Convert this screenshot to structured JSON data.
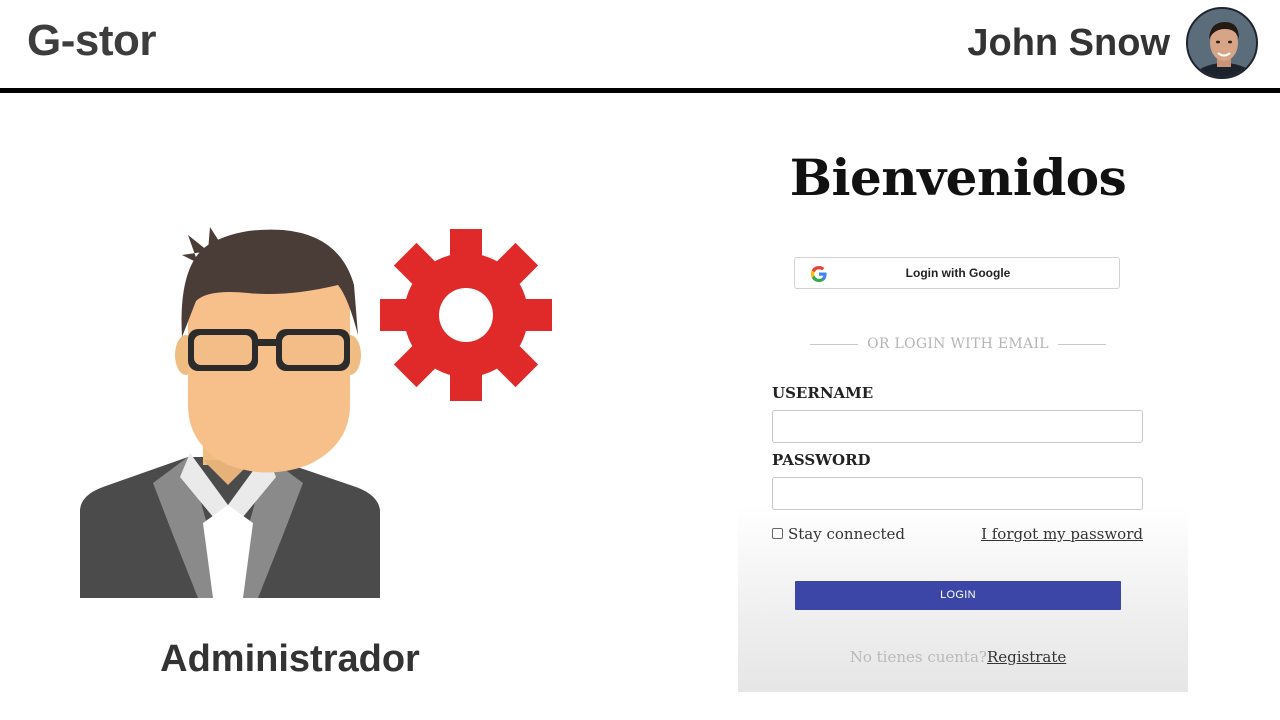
{
  "header": {
    "brand": "G-stor",
    "user_name": "John Snow",
    "avatar_icon": "user-avatar-photo"
  },
  "admin": {
    "label": "Administrador",
    "illustration_icons": [
      "admin-person-icon",
      "gear-icon"
    ],
    "gear_color": "#e02a2a"
  },
  "login": {
    "title": "Bienvenidos",
    "google_button": "Login with Google",
    "separator": "OR LOGIN WITH EMAIL",
    "username_label": "USERNAME",
    "username_value": "",
    "password_label": "PASSWORD",
    "password_value": "",
    "stay_connected": "Stay connected",
    "forgot_password": "I forgot my password",
    "login_button": "LOGIN",
    "signup_prompt": "No tienes cuenta?",
    "signup_link": "Registrate",
    "accent_color": "#3c46a7"
  }
}
